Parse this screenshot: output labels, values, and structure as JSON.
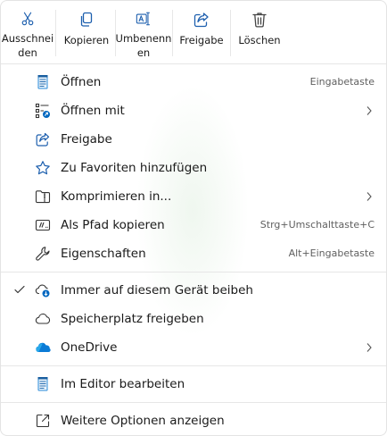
{
  "toolbar": {
    "cut": {
      "line1": "Ausschnei",
      "line2": "den",
      "icon": "scissors-icon"
    },
    "copy": {
      "line1": "Kopieren",
      "icon": "copy-icon"
    },
    "rename": {
      "line1": "Umbenenn",
      "line2": "en",
      "icon": "rename-icon"
    },
    "share": {
      "line1": "Freigabe",
      "icon": "share-icon"
    },
    "delete": {
      "line1": "Löschen",
      "icon": "trash-icon"
    }
  },
  "items": {
    "open": {
      "label": "Öffnen",
      "shortcut": "Eingabetaste",
      "icon": "notepad-icon"
    },
    "open_with": {
      "label": "Öffnen mit",
      "icon": "open-with-icon"
    },
    "share": {
      "label": "Freigabe",
      "icon": "share-icon"
    },
    "favorites": {
      "label": "Zu Favoriten hinzufügen",
      "icon": "star-icon"
    },
    "compress": {
      "label": "Komprimieren in...",
      "icon": "zip-folder-icon"
    },
    "copy_path": {
      "label": "Als Pfad kopieren",
      "shortcut": "Strg+Umschalttaste+C",
      "icon": "copy-path-icon"
    },
    "properties": {
      "label": "Eigenschaften",
      "shortcut": "Alt+Eingabetaste",
      "icon": "wrench-icon"
    },
    "keep_on_device": {
      "label": "Immer auf diesem Gerät beibeh",
      "icon": "cloud-keep-icon",
      "checked": true
    },
    "free_space": {
      "label": "Speicherplatz freigeben",
      "icon": "cloud-icon"
    },
    "onedrive": {
      "label": "OneDrive",
      "icon": "onedrive-icon"
    },
    "edit_in_editor": {
      "label": "Im Editor bearbeiten",
      "icon": "notepad-icon"
    },
    "more_options": {
      "label": "Weitere Optionen anzeigen",
      "icon": "expand-icon"
    }
  },
  "colors": {
    "accent": "#0067c0",
    "onedrive": "#0a7bd6",
    "text": "#1a1a1a",
    "secondary_text": "#5f5f5f",
    "separator": "#e6e6e6"
  }
}
